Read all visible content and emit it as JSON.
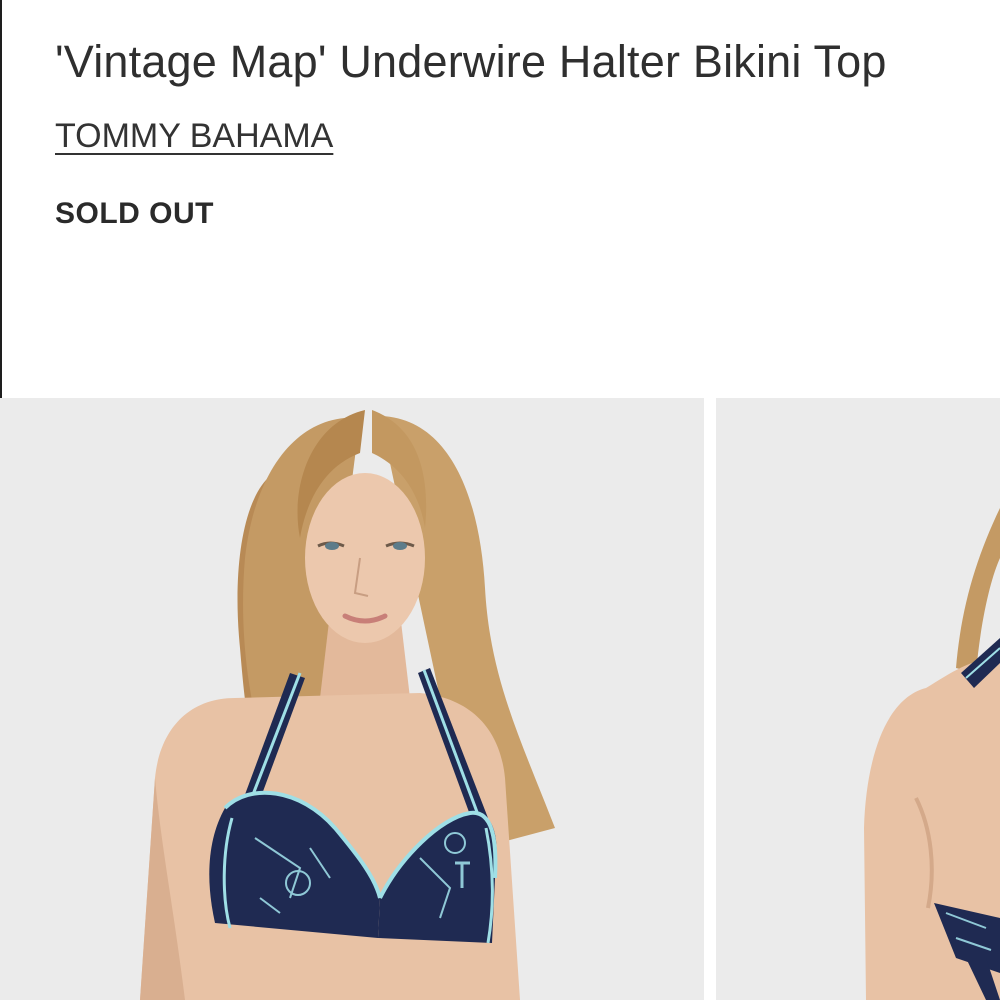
{
  "product": {
    "title": "'Vintage Map' Underwire Halter Bikini Top",
    "brand": "TOMMY BAHAMA",
    "status": "SOLD OUT"
  },
  "gallery": {
    "images": [
      {
        "view": "front"
      },
      {
        "view": "back"
      }
    ]
  },
  "colors": {
    "text": "#333333",
    "image_background": "#ebebeb",
    "swimsuit_navy": "#1f2a52",
    "trim_aqua": "#9fdfe6",
    "hair_blonde": "#c49a64",
    "skin": "#e8c2a5"
  }
}
